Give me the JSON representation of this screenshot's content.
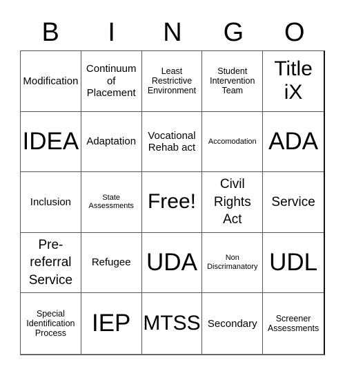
{
  "header": [
    "B",
    "I",
    "N",
    "G",
    "O"
  ],
  "cells": [
    {
      "text": "Modification",
      "size": "md"
    },
    {
      "text": "Continuum of Placement",
      "size": "md"
    },
    {
      "text": "Least Restrictive Environment",
      "size": "sm"
    },
    {
      "text": "Student Intervention Team",
      "size": "sm"
    },
    {
      "text": "Title iX",
      "size": "xl"
    },
    {
      "text": "IDEA",
      "size": "xxl"
    },
    {
      "text": "Adaptation",
      "size": "md"
    },
    {
      "text": "Vocational Rehab act",
      "size": "md"
    },
    {
      "text": "Accomodation",
      "size": "xs"
    },
    {
      "text": "ADA",
      "size": "xxl"
    },
    {
      "text": "Inclusion",
      "size": "md"
    },
    {
      "text": "State Assessments",
      "size": "xs"
    },
    {
      "text": "Free!",
      "size": "xl"
    },
    {
      "text": "Civil Rights Act",
      "size": "lg"
    },
    {
      "text": "Service",
      "size": "lg"
    },
    {
      "text": "Pre-referral Service",
      "size": "lg"
    },
    {
      "text": "Refugee",
      "size": "md"
    },
    {
      "text": "UDA",
      "size": "xxl"
    },
    {
      "text": "Non Discrimanatory",
      "size": "xs"
    },
    {
      "text": "UDL",
      "size": "xxl"
    },
    {
      "text": "Special Identification Process",
      "size": "sm"
    },
    {
      "text": "IEP",
      "size": "xxl"
    },
    {
      "text": "MTSS",
      "size": "xl"
    },
    {
      "text": "Secondary",
      "size": "md"
    },
    {
      "text": "Screener Assessments",
      "size": "sm"
    }
  ]
}
